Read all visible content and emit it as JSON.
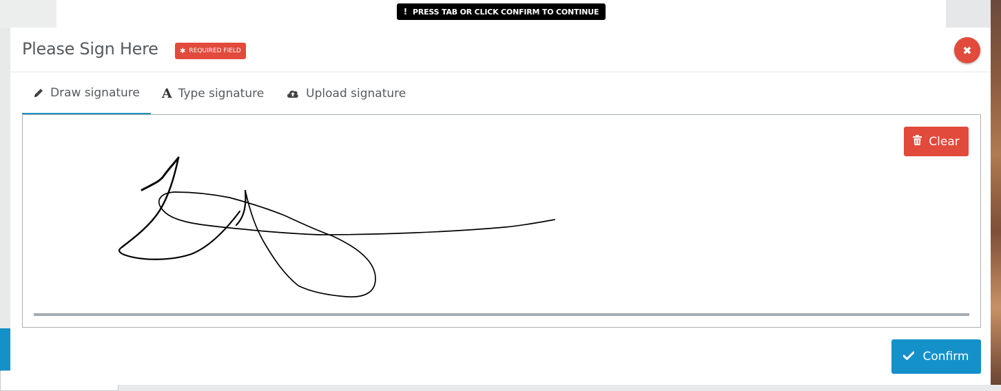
{
  "notice": {
    "text": "PRESS TAB OR CLICK CONFIRM TO CONTINUE",
    "icon": "exclamation-icon"
  },
  "modal": {
    "title": "Please Sign Here",
    "required_badge": "REQUIRED FIELD",
    "close_icon": "close-icon"
  },
  "tabs": [
    {
      "label": "Draw signature",
      "icon": "pencil-icon",
      "active": true
    },
    {
      "label": "Type signature",
      "icon": "font-icon",
      "active": false
    },
    {
      "label": "Upload signature",
      "icon": "cloud-upload-icon",
      "active": false
    }
  ],
  "canvas": {
    "clear_label": "Clear",
    "clear_icon": "trash-icon"
  },
  "footer": {
    "confirm_label": "Confirm",
    "confirm_icon": "check-icon"
  },
  "colors": {
    "accent": "#1591c9",
    "danger": "#e24a3b",
    "text": "#555a5e"
  }
}
